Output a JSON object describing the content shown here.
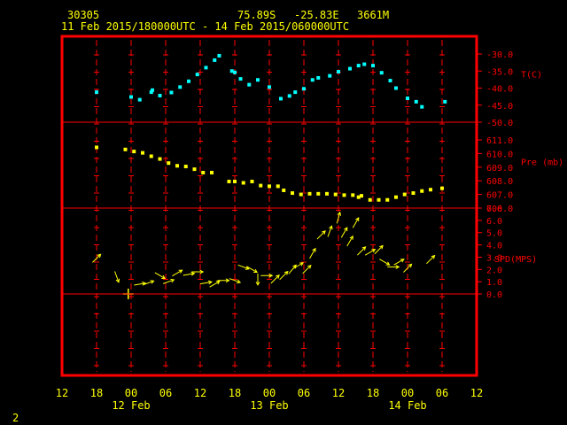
{
  "header": {
    "station": "30305",
    "latitude": "75.89S",
    "longitude": "-25.83E",
    "elevation": "3661M",
    "time_range": "11 Feb 2015/180000UTC - 14 Feb 2015/060000UTC"
  },
  "page_number": "2",
  "colors": {
    "frame": "#ff0000",
    "axis_text": "#ffff00",
    "right_labels": "#ff0000",
    "temperature": "#00ffff",
    "pressure": "#ffff00",
    "wind": "#ffff00"
  },
  "chart_data": {
    "type": "scatter",
    "x_unit": "hours since 11 Feb 2015 12:00 UTC",
    "xlim": [
      0,
      72
    ],
    "x_tick_labels": [
      "12",
      "18",
      "00",
      "06",
      "12",
      "18",
      "00",
      "06",
      "12",
      "18",
      "00",
      "06",
      "12"
    ],
    "day_labels": [
      {
        "text": "12 Feb",
        "x": 12
      },
      {
        "text": "13 Feb",
        "x": 36
      },
      {
        "text": "14 Feb",
        "x": 60
      }
    ],
    "panels": [
      {
        "name": "temperature",
        "label": "T(C)",
        "ylim": [
          -50,
          -30
        ],
        "tick_labels": [
          "-30.0",
          "-35.0",
          "-40.0",
          "-45.0",
          "-50.0"
        ],
        "tick_values": [
          -30,
          -35,
          -40,
          -45,
          -50
        ],
        "points": [
          [
            6,
            -41.2
          ],
          [
            12,
            -42.6
          ],
          [
            13.5,
            -43.4
          ],
          [
            15.5,
            -41.2
          ],
          [
            15.7,
            -40.6
          ],
          [
            17,
            -42.2
          ],
          [
            19,
            -41.3
          ],
          [
            20.5,
            -39.7
          ],
          [
            22,
            -38.0
          ],
          [
            23.5,
            -36.0
          ],
          [
            25,
            -34.0
          ],
          [
            26.5,
            -31.8
          ],
          [
            27.3,
            -30.5
          ],
          [
            29.5,
            -35.0
          ],
          [
            30,
            -35.4
          ],
          [
            31,
            -37.3
          ],
          [
            32.5,
            -39.0
          ],
          [
            34,
            -37.6
          ],
          [
            36,
            -39.7
          ],
          [
            38,
            -43.1
          ],
          [
            39.5,
            -42.3
          ],
          [
            40.5,
            -41.2
          ],
          [
            42,
            -40.2
          ],
          [
            43.5,
            -37.6
          ],
          [
            44.5,
            -37.0
          ],
          [
            46.5,
            -36.4
          ],
          [
            48,
            -35.2
          ],
          [
            50,
            -34.3
          ],
          [
            51.5,
            -33.4
          ],
          [
            52.5,
            -33.0
          ],
          [
            54,
            -33.4
          ],
          [
            55.5,
            -35.5
          ],
          [
            57,
            -37.8
          ],
          [
            58,
            -40.0
          ],
          [
            60,
            -43.0
          ],
          [
            61.5,
            -44.0
          ],
          [
            62.5,
            -45.5
          ],
          [
            66.5,
            -44.0
          ]
        ]
      },
      {
        "name": "pressure",
        "label": "Pre (mb)",
        "ylim": [
          606,
          611
        ],
        "tick_labels": [
          "611.0",
          "610.0",
          "609.0",
          "608.0",
          "607.0",
          "606.0"
        ],
        "tick_values": [
          611,
          610,
          609,
          608,
          607,
          606
        ],
        "points": [
          [
            6,
            610.45
          ],
          [
            11,
            610.3
          ],
          [
            12.5,
            610.15
          ],
          [
            14,
            610.05
          ],
          [
            15.5,
            609.8
          ],
          [
            17,
            609.6
          ],
          [
            18.5,
            609.3
          ],
          [
            20,
            609.1
          ],
          [
            21.5,
            609.05
          ],
          [
            23,
            608.85
          ],
          [
            24.5,
            608.6
          ],
          [
            26,
            608.6
          ],
          [
            29,
            607.95
          ],
          [
            30,
            607.95
          ],
          [
            31.5,
            607.85
          ],
          [
            33,
            607.95
          ],
          [
            34.5,
            607.65
          ],
          [
            36,
            607.6
          ],
          [
            37.5,
            607.6
          ],
          [
            38.5,
            607.3
          ],
          [
            40,
            607.1
          ],
          [
            41.5,
            607.0
          ],
          [
            43,
            607.05
          ],
          [
            44.5,
            607.05
          ],
          [
            46,
            607.05
          ],
          [
            47.5,
            607.0
          ],
          [
            49,
            606.95
          ],
          [
            50.5,
            606.95
          ],
          [
            51.5,
            606.8
          ],
          [
            52,
            606.9
          ],
          [
            53.5,
            606.6
          ],
          [
            55,
            606.6
          ],
          [
            56.5,
            606.6
          ],
          [
            58,
            606.8
          ],
          [
            59.5,
            607.0
          ],
          [
            61,
            607.1
          ],
          [
            62.5,
            607.25
          ],
          [
            64,
            607.35
          ],
          [
            66,
            607.45
          ]
        ]
      },
      {
        "name": "wind",
        "label": "SPD(MPS)",
        "ylim": [
          0,
          7
        ],
        "tick_labels": [
          "7.0",
          "6.0",
          "5.0",
          "4.0",
          "3.0",
          "2.0",
          "1.0",
          "0.0"
        ],
        "tick_values": [
          7,
          6,
          5,
          4,
          3,
          2,
          1,
          0
        ],
        "arrows": [
          [
            6,
            2.9,
            45
          ],
          [
            9.5,
            1.4,
            160
          ],
          [
            11.5,
            0,
            0
          ],
          [
            13.5,
            0.8,
            80
          ],
          [
            15,
            0.9,
            70
          ],
          [
            17,
            1.5,
            120
          ],
          [
            18.5,
            1.0,
            70
          ],
          [
            20,
            1.7,
            60
          ],
          [
            22,
            1.6,
            80
          ],
          [
            23.5,
            1.8,
            90
          ],
          [
            25,
            0.9,
            80
          ],
          [
            26.5,
            0.8,
            60
          ],
          [
            28,
            1.1,
            90
          ],
          [
            30,
            1.1,
            110
          ],
          [
            31.5,
            2.2,
            110
          ],
          [
            33,
            2.0,
            120
          ],
          [
            34,
            1.2,
            180
          ],
          [
            35.5,
            1.5,
            90
          ],
          [
            37,
            1.2,
            45
          ],
          [
            38.5,
            1.5,
            45
          ],
          [
            40,
            2.0,
            40
          ],
          [
            41,
            2.3,
            60
          ],
          [
            42.5,
            2.0,
            45
          ],
          [
            43.5,
            3.3,
            30
          ],
          [
            45,
            4.8,
            45
          ],
          [
            46.5,
            5.1,
            20
          ],
          [
            48,
            6.2,
            15
          ],
          [
            49,
            5.0,
            30
          ],
          [
            50,
            4.3,
            30
          ],
          [
            51,
            5.8,
            30
          ],
          [
            52,
            3.5,
            45
          ],
          [
            53.5,
            3.4,
            60
          ],
          [
            55,
            3.6,
            45
          ],
          [
            56,
            2.6,
            120
          ],
          [
            57.5,
            2.2,
            90
          ],
          [
            58.5,
            2.6,
            60
          ],
          [
            60,
            2.1,
            45
          ],
          [
            64,
            2.8,
            45
          ]
        ]
      }
    ]
  }
}
